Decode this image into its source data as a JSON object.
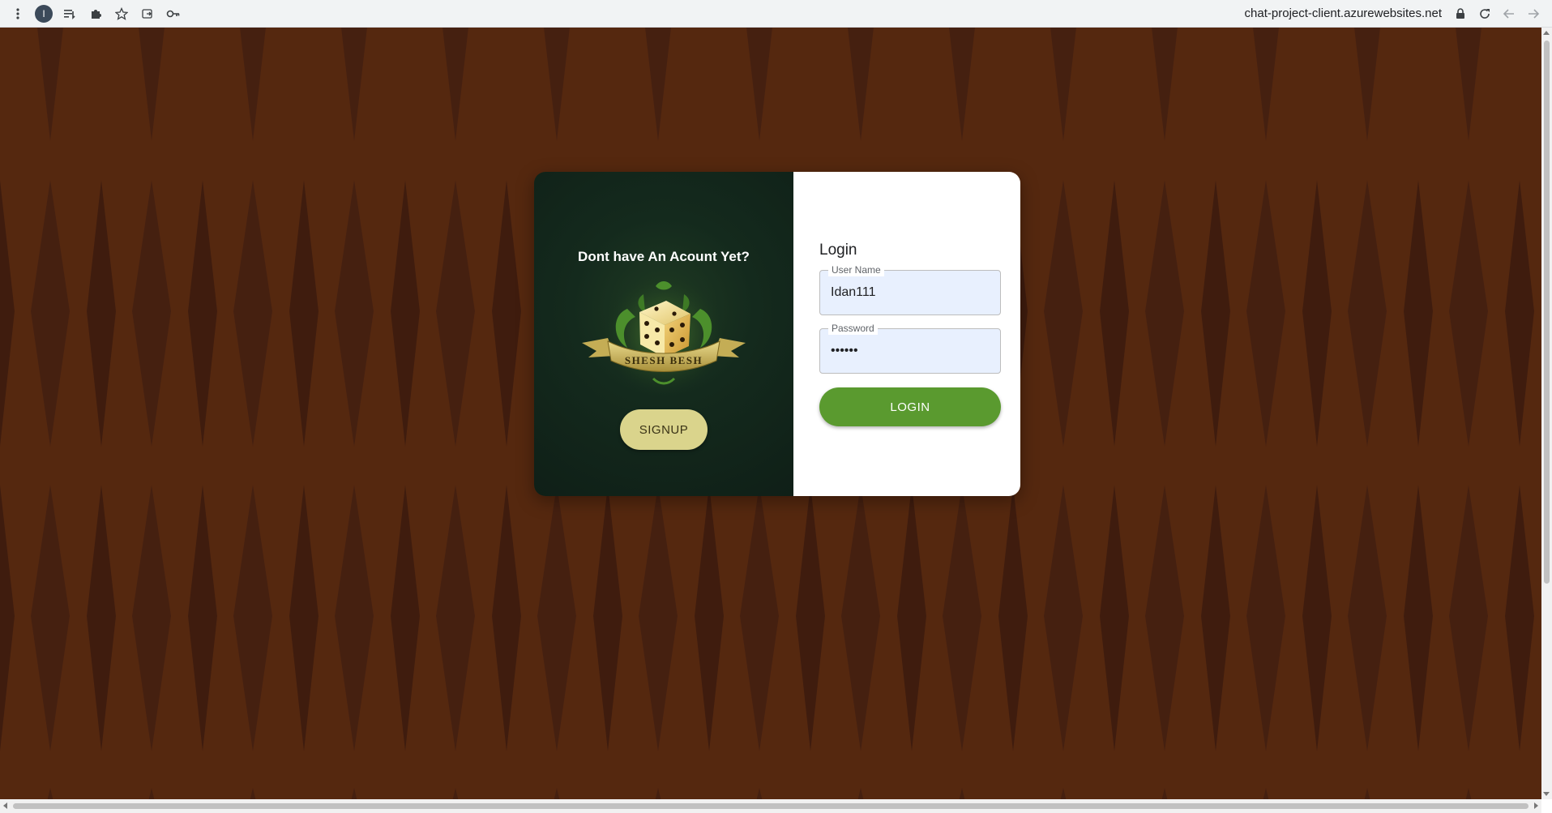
{
  "browser": {
    "profile_initial": "I",
    "url": "chat-project-client.azurewebsites.net",
    "icons": {
      "menu": "kebab-menu-icon",
      "reading_list": "reading-list-icon",
      "extensions": "puzzle-icon",
      "bookmark": "star-icon",
      "share": "share-icon",
      "passwords": "key-icon",
      "lock": "lock-icon",
      "reload": "reload-icon",
      "back": "arrow-left-icon",
      "forward": "arrow-right-icon"
    }
  },
  "colors": {
    "background": "#55280f",
    "promo_panel": "#142a1d",
    "signup_button": "#dad48c",
    "login_button": "#5a9a2f"
  },
  "promo": {
    "title": "Dont have An Acount Yet?",
    "logo_text": "SHESH BESH",
    "signup_label": "SIGNUP"
  },
  "login": {
    "title": "Login",
    "username_label": "User Name",
    "username_value": "Idan111",
    "password_label": "Password",
    "password_value": "••••••",
    "login_label": "LOGIN"
  }
}
